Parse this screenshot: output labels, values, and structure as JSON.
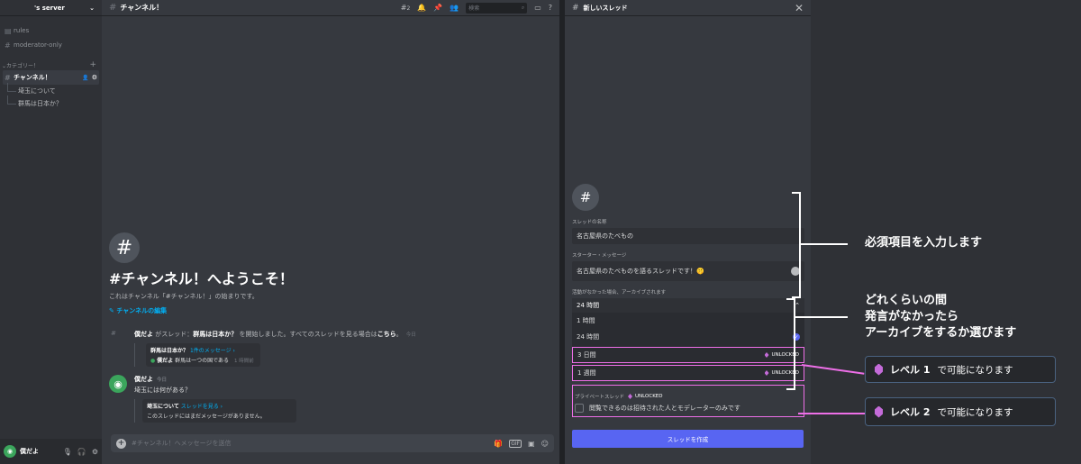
{
  "sidebar": {
    "server_name": "'s server",
    "channels": [
      {
        "icon": "rules-icon",
        "label": "rules"
      },
      {
        "icon": "hash-icon",
        "label": "moderator-only"
      }
    ],
    "category": "カテゴリー！",
    "active_channel": "チャンネル！",
    "threads": [
      "埼玉について",
      "群馬は日本か？"
    ],
    "user": {
      "name": "僕だよ"
    }
  },
  "chat": {
    "header_title": "チャンネル！",
    "threads_count": "2",
    "search_placeholder": "検索",
    "welcome_title": "#チャンネル！へようこそ！",
    "welcome_sub": "これはチャンネル「#チャンネル！」の始まりです。",
    "welcome_edit": "チャンネルの編集",
    "sys_msg": {
      "user": "僕だよ",
      "text1": " がスレッド：",
      "thread": "群馬は日本か？",
      "text2": " を開始しました。すべてのスレッドを見る場合は",
      "here": "こちら",
      "text3": "。",
      "time": "今日",
      "card_title": "群馬は日本か？",
      "card_link": "1件のメッセージ ›",
      "card_user": "僕だよ",
      "card_msg": "群馬は一つの国である",
      "card_time": "1 時間前"
    },
    "msg": {
      "user": "僕だよ",
      "time": "今日",
      "text": "埼玉には何がある？",
      "card_title": "埼玉について",
      "card_link": "スレッドを見る ›",
      "card_msg": "このスレッドにはまだメッセージがありません。"
    },
    "composer_placeholder": "#チャンネル！へメッセージを送信",
    "gif_label": "GIF"
  },
  "panel": {
    "title": "新しいスレッド",
    "name_label": "スレッドの名称",
    "name_value": "名古屋県のたべもの",
    "starter_label": "スターター・メッセージ",
    "starter_value": "名古屋県のたべものを語るスレッドです！🤫",
    "archive_label": "活動がなかった場合、アーカイブされます",
    "selected": "24 時間",
    "options": [
      {
        "label": "1 時間"
      },
      {
        "label": "24 時間"
      },
      {
        "label": "3 日間",
        "unlocked": "UNLOCKED"
      },
      {
        "label": "1 週間",
        "unlocked": "UNLOCKED"
      }
    ],
    "private_label": "プライベートスレッド",
    "private_unlocked": "UNLOCKED",
    "private_desc": "閲覧できるのは招待された人とモデレーターのみです",
    "create_button": "スレッドを作成"
  },
  "annotations": {
    "required": "必須項目を入力します",
    "archive_l1": "どれくらいの間",
    "archive_l2": "発言がなかったら",
    "archive_l3": "アーカイブをするか選びます",
    "level1": "レベル 1",
    "level1_rest": "で可能になります",
    "level2": "レベル 2",
    "level2_rest": "で可能になります"
  },
  "colors": {
    "accent": "#5865f2",
    "link": "#00b0f4",
    "highlight": "#ee6fe8",
    "gem": "#c46bd9"
  }
}
